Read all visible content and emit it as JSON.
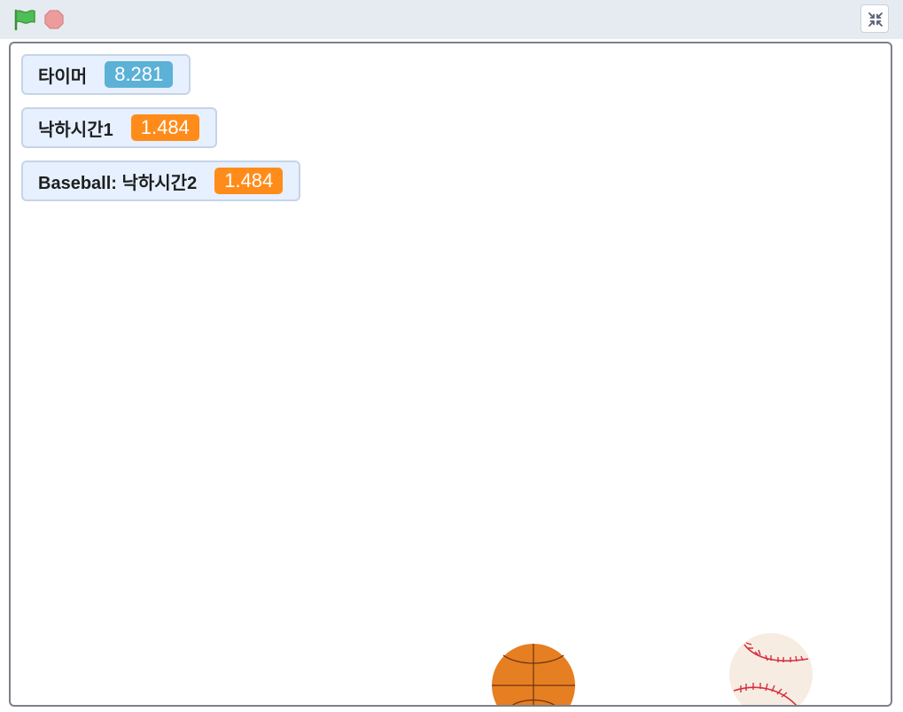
{
  "toolbar": {
    "green_flag_icon": "green-flag-icon",
    "stop_icon": "stop-sign-icon",
    "fullscreen_icon": "exit-fullscreen-icon"
  },
  "colors": {
    "topbar_bg": "#e6ebf2",
    "stage_border": "#7c818a",
    "monitor_bg": "#e6f0ff",
    "monitor_border": "#c6d4e6",
    "timer_value_bg": "#5cb1d6",
    "list_value_bg": "#ff8c1a",
    "basketball": "#e67e22",
    "baseball": "#f7ece1",
    "baseball_stitch": "#d62f43"
  },
  "monitors": [
    {
      "label": "타이머",
      "value": "8.281",
      "kind": "sensing"
    },
    {
      "label": "낙하시간1",
      "value": "1.484",
      "kind": "variable"
    },
    {
      "label": "Baseball: 낙하시간2",
      "value": "1.484",
      "kind": "variable"
    }
  ],
  "sprites": [
    {
      "name": "basketball"
    },
    {
      "name": "baseball"
    }
  ]
}
